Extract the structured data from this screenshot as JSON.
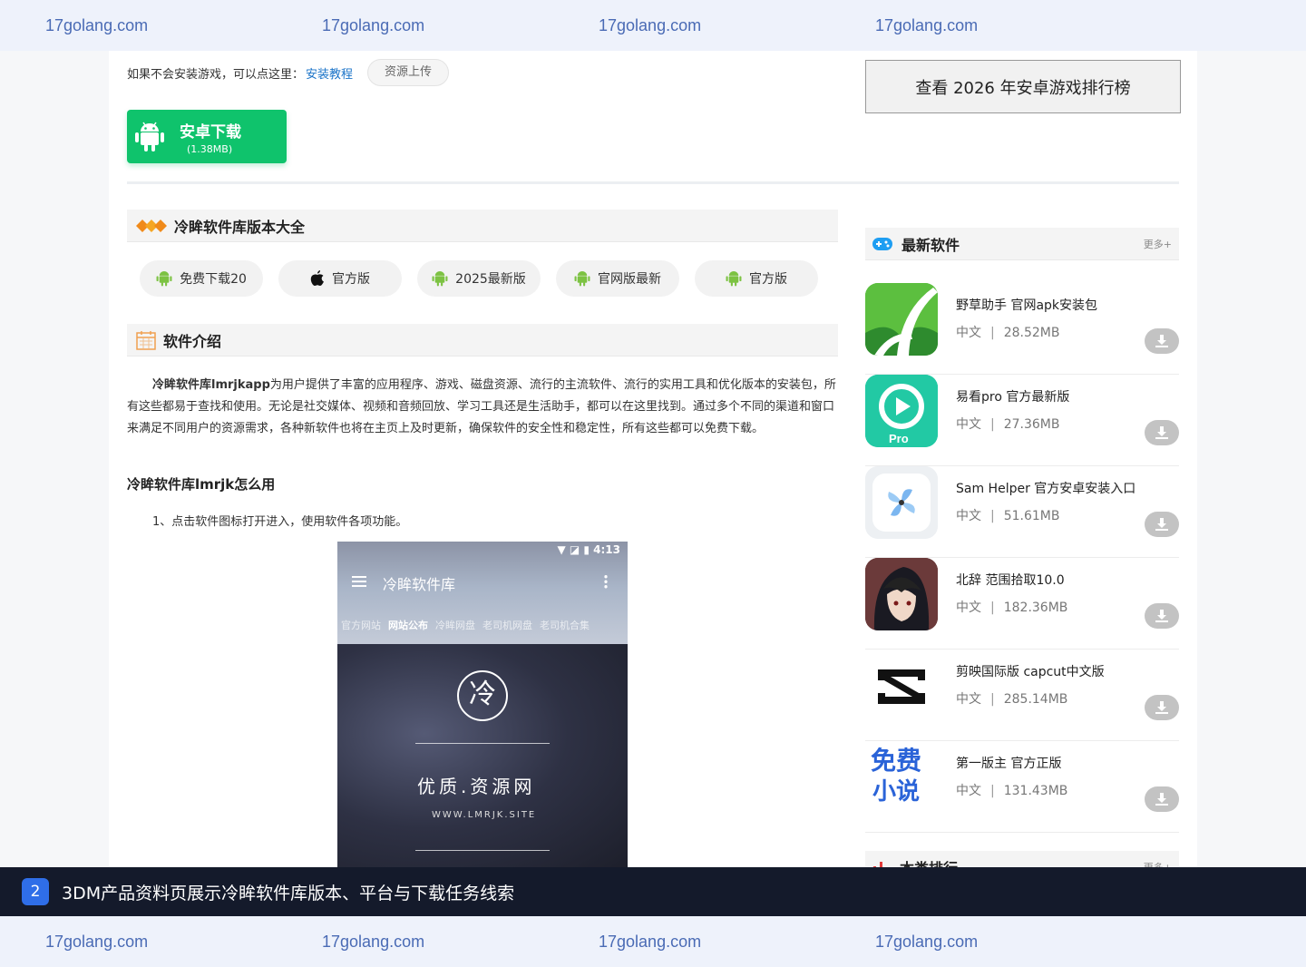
{
  "watermark": {
    "text": "17golang.com"
  },
  "install": {
    "hint": "如果不会安装游戏，可以点这里：",
    "link": "安装教程",
    "upload": "资源上传"
  },
  "download": {
    "label": "安卓下载",
    "size": "(1.38MB)"
  },
  "rank_button": "查看 2026 年安卓游戏排行榜",
  "versions_section": {
    "title": "冷眸软件库版本大全",
    "items": [
      {
        "label": "免费下载20",
        "icon": "android-icon"
      },
      {
        "label": "官方版",
        "icon": "apple-icon"
      },
      {
        "label": "2025最新版",
        "icon": "android-icon"
      },
      {
        "label": "官网版最新",
        "icon": "android-icon"
      },
      {
        "label": "官方版",
        "icon": "android-icon"
      }
    ]
  },
  "intro_section": {
    "title": "软件介绍",
    "lead": "冷眸软件库lmrjkapp",
    "body": "为用户提供了丰富的应用程序、游戏、磁盘资源、流行的主流软件、流行的实用工具和优化版本的安装包，所有这些都易于查找和使用。无论是社交媒体、视频和音频回放、学习工具还是生活助手，都可以在这里找到。通过多个不同的渠道和窗口来满足不同用户的资源需求，各种新软件也将在主页上及时更新，确保软件的安全性和稳定性，所有这些都可以免费下载。",
    "howto_title": "冷眸软件库lmrjk怎么用",
    "step1": "1、点击软件图标打开进入，使用软件各项功能。"
  },
  "screenshot": {
    "time": "4:13",
    "app_title": "冷眸软件库",
    "tabs": [
      "官方网站",
      "网站公布",
      "冷眸网盘",
      "老司机网盘",
      "老司机合集"
    ],
    "logo_char": "冷",
    "slogan": "优质.资源网",
    "site": "WWW.LMRJK.SITE"
  },
  "latest": {
    "title": "最新软件",
    "more": "更多+",
    "apps": [
      {
        "name": "野草助手 官网apk安装包",
        "lang": "中文",
        "size": "28.52MB",
        "icon": "grass-helper-icon"
      },
      {
        "name": "易看pro 官方最新版",
        "lang": "中文",
        "size": "27.36MB",
        "icon": "yikan-pro-icon"
      },
      {
        "name": "Sam Helper 官方安卓安装入口",
        "lang": "中文",
        "size": "51.61MB",
        "icon": "sam-helper-icon"
      },
      {
        "name": "北辞 范围拾取10.0",
        "lang": "中文",
        "size": "182.36MB",
        "icon": "beici-icon"
      },
      {
        "name": "剪映国际版 capcut中文版",
        "lang": "中文",
        "size": "285.14MB",
        "icon": "capcut-icon"
      },
      {
        "name": "第一版主 官方正版",
        "lang": "中文",
        "size": "131.43MB",
        "icon": "free-novel-icon"
      }
    ],
    "icon_label_pro": "Pro",
    "icon_label_free": [
      "免费",
      "小说"
    ]
  },
  "category": {
    "title": "本类排行",
    "more": "更多+"
  },
  "caption": {
    "number": "2",
    "text": "3DM产品资料页展示冷眸软件库版本、平台与下载任务线索"
  },
  "colors": {
    "accent_green": "#0fc36c",
    "link_blue": "#1a73c8",
    "caption_bg": "#141a2b",
    "badge_blue": "#2f6ee8"
  }
}
